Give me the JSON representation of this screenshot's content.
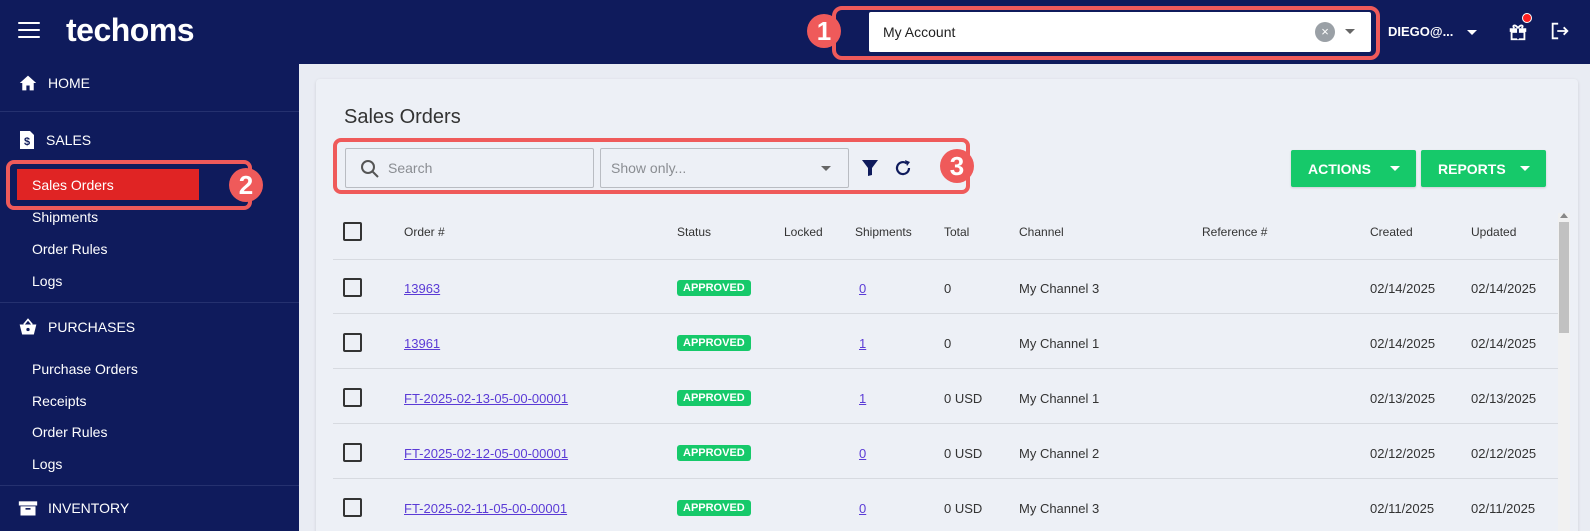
{
  "app": {
    "logo": "techoms",
    "account_selector": "My Account",
    "user": "DIEGO@...",
    "colors": {
      "nav_bg": "#0f1b5c",
      "accent_green": "#16c96a",
      "highlight_red": "#ef5a5a",
      "active_red": "#e02424"
    }
  },
  "annotations": [
    "1",
    "2",
    "3"
  ],
  "sidebar": {
    "home": "HOME",
    "sales": {
      "label": "SALES",
      "items": [
        "Sales Orders",
        "Shipments",
        "Order Rules",
        "Logs"
      ]
    },
    "purchases": {
      "label": "PURCHASES",
      "items": [
        "Purchase Orders",
        "Receipts",
        "Order Rules",
        "Logs"
      ]
    },
    "inventory": "INVENTORY"
  },
  "page": {
    "title": "Sales Orders",
    "search_placeholder": "Search",
    "show_only_placeholder": "Show only...",
    "actions_label": "ACTIONS",
    "reports_label": "REPORTS"
  },
  "table": {
    "headers": [
      "Order #",
      "Status",
      "Locked",
      "Shipments",
      "Total",
      "Channel",
      "Reference #",
      "Created",
      "Updated"
    ],
    "rows": [
      {
        "order": "13963",
        "status": "APPROVED",
        "locked": "",
        "shipments": "0",
        "total": "0",
        "channel": "My Channel 3",
        "reference": "",
        "created": "02/14/2025",
        "updated": "02/14/2025"
      },
      {
        "order": "13961",
        "status": "APPROVED",
        "locked": "",
        "shipments": "1",
        "total": "0",
        "channel": "My Channel 1",
        "reference": "",
        "created": "02/14/2025",
        "updated": "02/14/2025"
      },
      {
        "order": "FT-2025-02-13-05-00-00001",
        "status": "APPROVED",
        "locked": "",
        "shipments": "1",
        "total": "0 USD",
        "channel": "My Channel 1",
        "reference": "",
        "created": "02/13/2025",
        "updated": "02/13/2025"
      },
      {
        "order": "FT-2025-02-12-05-00-00001",
        "status": "APPROVED",
        "locked": "",
        "shipments": "0",
        "total": "0 USD",
        "channel": "My Channel 2",
        "reference": "",
        "created": "02/12/2025",
        "updated": "02/12/2025"
      },
      {
        "order": "FT-2025-02-11-05-00-00001",
        "status": "APPROVED",
        "locked": "",
        "shipments": "0",
        "total": "0 USD",
        "channel": "My Channel 3",
        "reference": "",
        "created": "02/11/2025",
        "updated": "02/11/2025"
      }
    ]
  }
}
